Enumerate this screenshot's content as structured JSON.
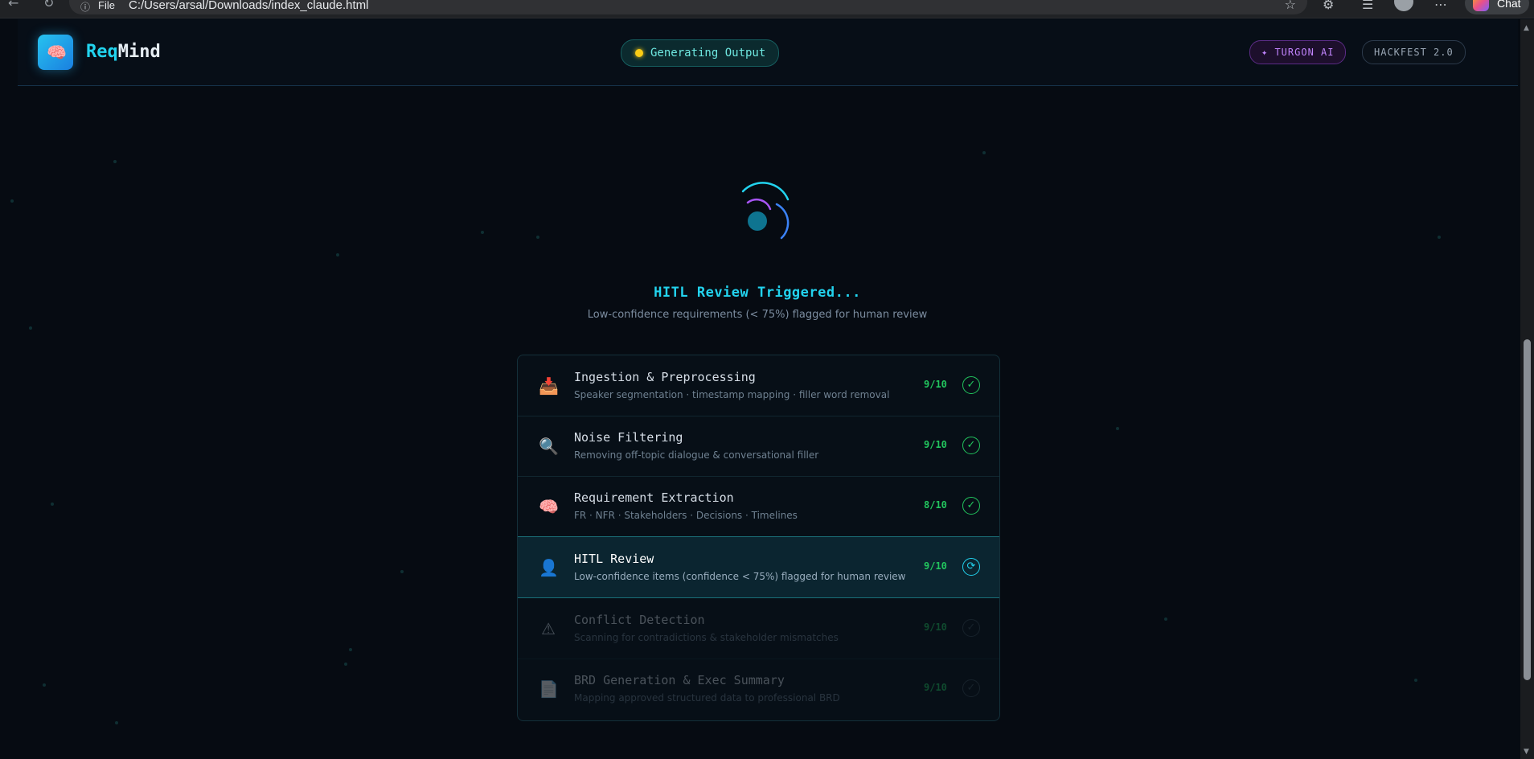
{
  "browser": {
    "scheme_label": "File",
    "url": "C:/Users/arsal/Downloads/index_claude.html",
    "chat_label": "Chat"
  },
  "header": {
    "brand_prefix": "Req",
    "brand_suffix": "Mind",
    "status": "Generating Output",
    "badge_turgon": "✦ TURGON AI",
    "badge_hackfest": "HACKFEST 2.0"
  },
  "main": {
    "headline": "HITL Review Triggered...",
    "subline": "Low-confidence requirements (< 75%) flagged for human review"
  },
  "pipeline": {
    "steps": [
      {
        "title": "Ingestion & Preprocessing",
        "desc": "Speaker segmentation · timestamp mapping · filler word removal",
        "score": "9/10",
        "state": "done"
      },
      {
        "title": "Noise Filtering",
        "desc": "Removing off-topic dialogue & conversational filler",
        "score": "9/10",
        "state": "done"
      },
      {
        "title": "Requirement Extraction",
        "desc": "FR · NFR · Stakeholders · Decisions · Timelines",
        "score": "8/10",
        "state": "done"
      },
      {
        "title": "HITL Review",
        "desc": "Low-confidence items (confidence < 75%) flagged for human review",
        "score": "9/10",
        "state": "running"
      },
      {
        "title": "Conflict Detection",
        "desc": "Scanning for contradictions & stakeholder mismatches",
        "score": "9/10",
        "state": "pending"
      },
      {
        "title": "BRD Generation & Exec Summary",
        "desc": "Mapping approved structured data to professional BRD",
        "score": "9/10",
        "state": "pending"
      }
    ]
  },
  "icons": {
    "step_icons": [
      "inbox-tray-icon",
      "magnifier-icon",
      "brain-icon",
      "person-icon",
      "warning-icon",
      "document-icon"
    ],
    "done": "check-icon",
    "running": "refresh-icon"
  },
  "colors": {
    "accent": "#22d3ee",
    "success": "#22c55e",
    "status_dot": "#facc15",
    "turgon": "#c084fc"
  }
}
